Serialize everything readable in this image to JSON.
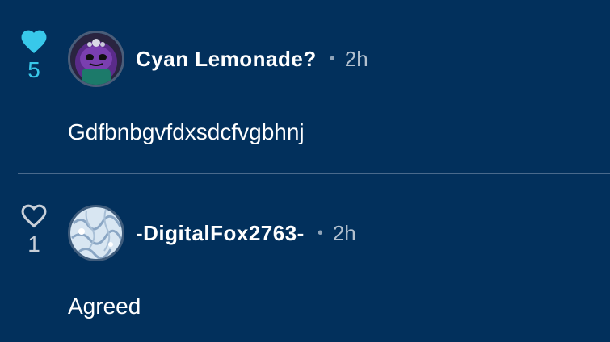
{
  "comments": [
    {
      "likes": "5",
      "liked": true,
      "username": "Cyan Lemonade?",
      "separator": "•",
      "time": "2h",
      "text": "Gdfbnbgvfdxsdcfvgbhnj",
      "heart_color": "#38c8ea"
    },
    {
      "likes": "1",
      "liked": false,
      "username": "-DigitalFox2763-",
      "separator": "•",
      "time": "2h",
      "text": "Agreed",
      "heart_color": "#c8cfd8"
    }
  ],
  "colors": {
    "background": "#02305c",
    "divider": "#4a6a8c",
    "timestamp": "#b3c0ce"
  }
}
